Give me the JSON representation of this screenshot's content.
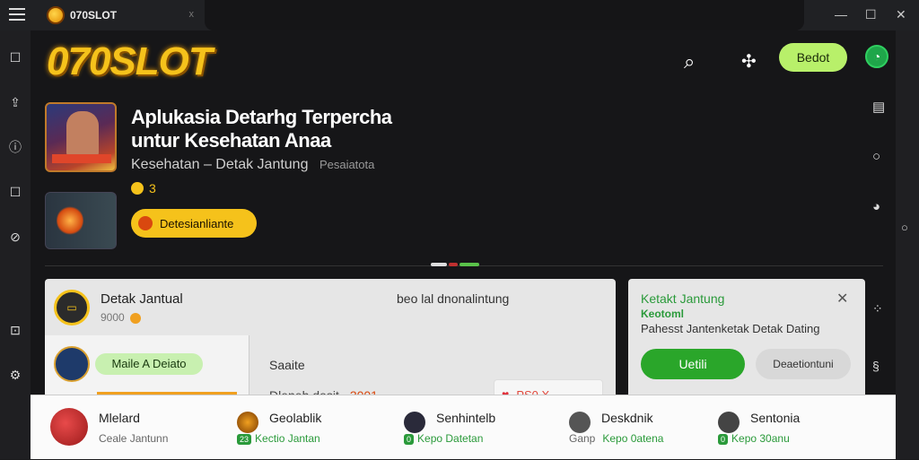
{
  "window": {
    "tab_title": "070SLOT",
    "tab_close": "x",
    "controls": [
      "—",
      "☐",
      "✕"
    ]
  },
  "header": {
    "brand": "070SLOT",
    "beta_label": "Bedot"
  },
  "hero": {
    "title_line1": "Aplukasia Detarhg Terpercha",
    "title_line2": "untur Kesehatan Anaa",
    "subtitle": "Kesehatan – Detak Jantung",
    "meta": "Pesaiatota",
    "rating": "3",
    "download_label": "Detesianliante"
  },
  "panel_left": {
    "name": "Detak Jantual",
    "sub": "9000",
    "header_right": "beo lal dnonalintung",
    "inner_pill": "Maile A Deiato",
    "label_a": "Saaite",
    "label_b": "Dleneh dosit",
    "label_b_value": "3001",
    "price": "PS0 X"
  },
  "panel_right": {
    "title": "Ketakt Jantung",
    "subtitle": "Keotoml",
    "desc": "Pahesst Jantenketak Detak Dating",
    "btn_primary": "Uetili",
    "btn_secondary": "Deaetiontuni"
  },
  "bottom_items": [
    {
      "name": "Mlelard",
      "sub": "Ceale Jantunn",
      "badge": ""
    },
    {
      "name": "Geolablik",
      "sub": "Kectio Jantan",
      "badge": "23"
    },
    {
      "name": "Senhintelb",
      "sub": "Kepo Datetan",
      "badge": "0"
    },
    {
      "name": "Deskdnik",
      "sub": "Kepo 0atena",
      "badge": "",
      "prefix": "Ganp"
    },
    {
      "name": "Sentonia",
      "sub": "Kepo 30anu",
      "badge": "0"
    }
  ],
  "colors": {
    "brand_gold": "#f5c21b",
    "accent_green": "#2aa62a",
    "lime": "#b8f06a"
  }
}
